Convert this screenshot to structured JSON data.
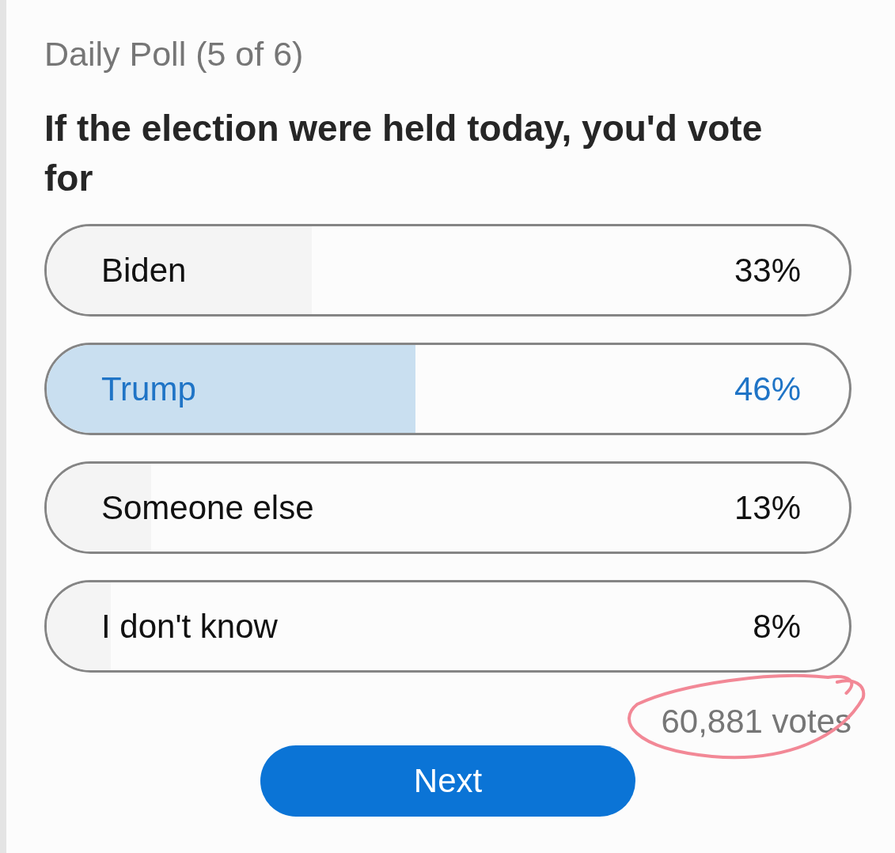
{
  "header": {
    "title": "Daily Poll (5 of 6)"
  },
  "question": "If the election were held today, you'd vote for",
  "options": [
    {
      "label": "Biden",
      "percent": "33%",
      "level": 0.33,
      "selected": false
    },
    {
      "label": "Trump",
      "percent": "46%",
      "level": 0.46,
      "selected": true
    },
    {
      "label": "Someone else",
      "percent": "13%",
      "level": 0.13,
      "selected": false
    },
    {
      "label": "I don't know",
      "percent": "8%",
      "level": 0.08,
      "selected": false
    }
  ],
  "votes": {
    "text": "60,881 votes",
    "circled": true
  },
  "next_button": "Next"
}
